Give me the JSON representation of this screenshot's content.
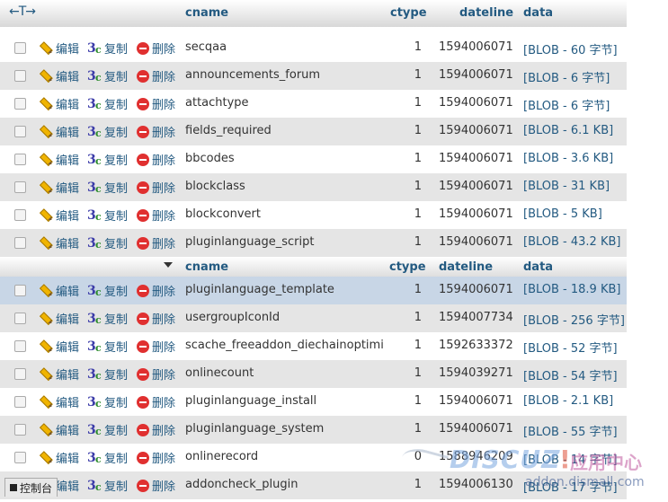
{
  "header": {
    "arrows": "←T→",
    "cols": {
      "cname": "cname",
      "ctype": "ctype",
      "dateline": "dateline",
      "data": "data"
    }
  },
  "actions": {
    "edit": "编辑",
    "copy": "复制",
    "delete": "删除"
  },
  "rows_top": [
    {
      "cname": "secqaa",
      "ctype": "1",
      "dateline": "1594006071",
      "data": "[BLOB - 60 字节]"
    },
    {
      "cname": "announcements_forum",
      "ctype": "1",
      "dateline": "1594006071",
      "data": "[BLOB - 6 字节]"
    },
    {
      "cname": "attachtype",
      "ctype": "1",
      "dateline": "1594006071",
      "data": "[BLOB - 6 字节]"
    },
    {
      "cname": "fields_required",
      "ctype": "1",
      "dateline": "1594006071",
      "data": "[BLOB - 6.1 KB]"
    },
    {
      "cname": "bbcodes",
      "ctype": "1",
      "dateline": "1594006071",
      "data": "[BLOB - 3.6 KB]"
    },
    {
      "cname": "blockclass",
      "ctype": "1",
      "dateline": "1594006071",
      "data": "[BLOB - 31 KB]"
    },
    {
      "cname": "blockconvert",
      "ctype": "1",
      "dateline": "1594006071",
      "data": "[BLOB - 5 KB]"
    },
    {
      "cname": "pluginlanguage_script",
      "ctype": "1",
      "dateline": "1594006071",
      "data": "[BLOB - 43.2 KB]"
    }
  ],
  "rows_bottom": [
    {
      "cname": "pluginlanguage_template",
      "ctype": "1",
      "dateline": "1594006071",
      "data": "[BLOB - 18.9 KB]"
    },
    {
      "cname": "usergroupIconId",
      "ctype": "1",
      "dateline": "1594007734",
      "data": "[BLOB - 256 字节]"
    },
    {
      "cname": "scache_freeaddon_diechainoptimiz",
      "ctype": "1",
      "dateline": "1592633372",
      "data": "[BLOB - 52 字节]"
    },
    {
      "cname": "onlinecount",
      "ctype": "1",
      "dateline": "1594039271",
      "data": "[BLOB - 54 字节]"
    },
    {
      "cname": "pluginlanguage_install",
      "ctype": "1",
      "dateline": "1594006071",
      "data": "[BLOB - 2.1 KB]"
    },
    {
      "cname": "pluginlanguage_system",
      "ctype": "1",
      "dateline": "1594006071",
      "data": "[BLOB - 55 字节]"
    },
    {
      "cname": "onlinerecord",
      "ctype": "0",
      "dateline": "1588946209",
      "data": "[BLOB - 14 字节]"
    },
    {
      "cname": "addoncheck_plugin",
      "ctype": "1",
      "dateline": "1594006130",
      "data": "[BLOB - 17 字节]"
    }
  ],
  "console": {
    "label": "控制台"
  },
  "watermark": {
    "logo": "DISCUZ",
    "bang": "!",
    "cn": "应用中心",
    "url": "addon.dismall.com"
  },
  "colors": {
    "link": "#235a81",
    "row_even": "#e5e5e5",
    "row_highlight": "#c8d6e6",
    "delete": "#e03030"
  }
}
